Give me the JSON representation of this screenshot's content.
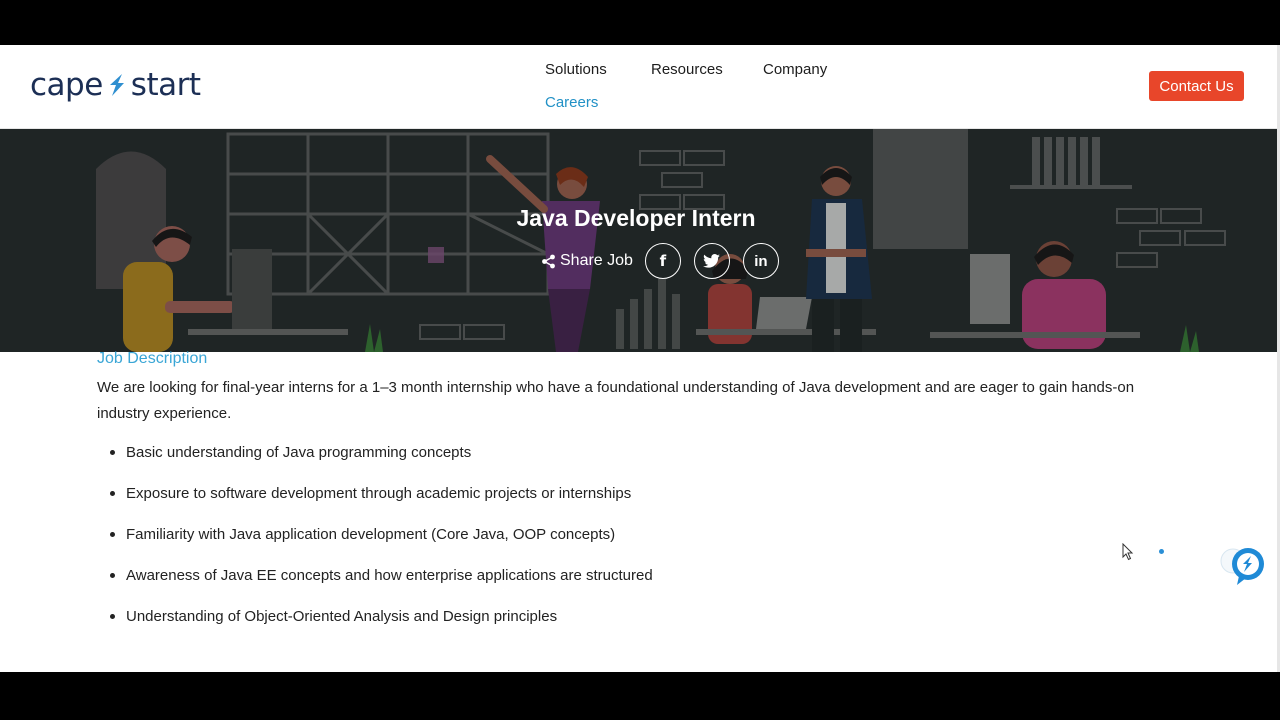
{
  "header": {
    "logo_left": "cape",
    "logo_right": "start",
    "nav": [
      {
        "label": "Solutions"
      },
      {
        "label": "Resources"
      },
      {
        "label": "Company"
      },
      {
        "label": "Careers"
      }
    ],
    "contact_label": "Contact Us"
  },
  "hero": {
    "title": "Java Developer Intern",
    "share_label": "Share Job",
    "socials": [
      {
        "icon": "facebook-icon",
        "glyph": "f"
      },
      {
        "icon": "twitter-icon",
        "glyph": ""
      },
      {
        "icon": "linkedin-icon",
        "glyph": "in"
      }
    ]
  },
  "content": {
    "heading": "Job Description",
    "intro": "We are looking for final-year interns for a 1–3 month internship who have a foundational understanding of Java development and are eager to gain hands-on industry experience.",
    "requirements": [
      "Basic understanding of Java programming concepts",
      "Exposure to software development through academic projects or internships",
      "Familiarity with Java application development (Core Java, OOP concepts)",
      "Awareness of Java EE concepts and how enterprise applications are structured",
      "Understanding of Object-Oriented Analysis and Design principles"
    ]
  },
  "colors": {
    "accent": "#2291c6",
    "cta": "#e8462a",
    "logo": "#1c2f55",
    "hero_bg": "#2a3130"
  }
}
